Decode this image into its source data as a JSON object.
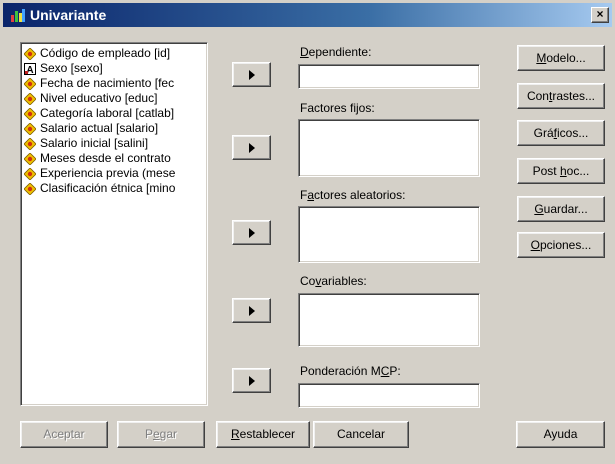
{
  "window": {
    "title": "Univariante",
    "close_label": "×"
  },
  "variables": [
    {
      "label": "Código de empleado [id]",
      "icon": "scale-icon"
    },
    {
      "label": "Sexo [sexo]",
      "icon": "string-icon"
    },
    {
      "label": "Fecha de nacimiento [fec",
      "icon": "scale-icon"
    },
    {
      "label": "Nivel educativo [educ]",
      "icon": "scale-icon"
    },
    {
      "label": "Categoría laboral [catlab]",
      "icon": "scale-icon"
    },
    {
      "label": "Salario actual [salario]",
      "icon": "scale-icon"
    },
    {
      "label": "Salario inicial [salini]",
      "icon": "scale-icon"
    },
    {
      "label": "Meses desde el contrato",
      "icon": "scale-icon"
    },
    {
      "label": "Experiencia previa (mese",
      "icon": "scale-icon"
    },
    {
      "label": "Clasificación étnica [mino",
      "icon": "scale-icon"
    }
  ],
  "targets": {
    "dependiente": {
      "pre": "",
      "key": "D",
      "post": "ependiente:"
    },
    "factores_fijos": {
      "pre": "",
      "key": "",
      "post": "Factores fijos:"
    },
    "factores_aleatorios": {
      "pre": "F",
      "key": "a",
      "post": "ctores aleatorios:"
    },
    "covariables": {
      "pre": "Co",
      "key": "v",
      "post": "ariables:"
    },
    "ponderacion": {
      "pre": "Ponderación M",
      "key": "C",
      "post": "P:"
    }
  },
  "side_buttons": [
    {
      "pre": "",
      "key": "M",
      "post": "odelo..."
    },
    {
      "pre": "Con",
      "key": "t",
      "post": "rastes..."
    },
    {
      "pre": "Grá",
      "key": "f",
      "post": "icos..."
    },
    {
      "pre": "Post ",
      "key": "h",
      "post": "oc..."
    },
    {
      "pre": "",
      "key": "G",
      "post": "uardar..."
    },
    {
      "pre": "",
      "key": "O",
      "post": "pciones..."
    }
  ],
  "bottom_buttons": {
    "aceptar": "Aceptar",
    "pegar": {
      "pre": "P",
      "key": "e",
      "post": "gar"
    },
    "restablecer": {
      "pre": "",
      "key": "R",
      "post": "establecer"
    },
    "cancelar": "Cancelar",
    "ayuda": "Ayuda"
  },
  "colors": {
    "title_start": "#0a246a",
    "title_end": "#a6caf0",
    "face": "#d4d0c8"
  }
}
